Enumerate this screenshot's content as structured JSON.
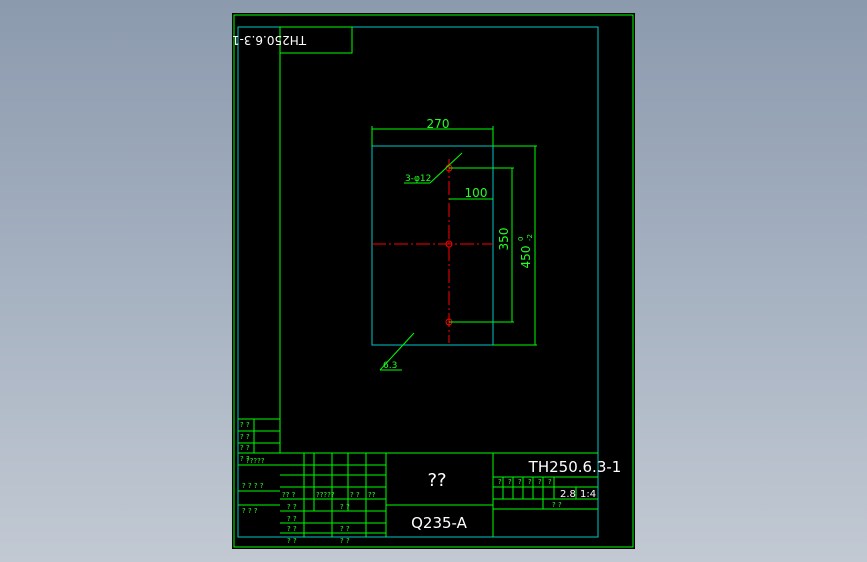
{
  "colors": {
    "frame": "#00ff00",
    "outline": "#00c8c8",
    "centerline": "#ff0000",
    "dimension": "#00ff00",
    "text_white": "#ffffff"
  },
  "drawing": {
    "stamp_code_mirrored": "TH250.6.3-1",
    "dimensions": {
      "width": "270",
      "hole_offset": "100",
      "hole_spacing": "350",
      "height": "450",
      "height_tol_upper": "0",
      "height_tol_lower": "-2",
      "holes": "3-φ12",
      "roughness": "6.3"
    }
  },
  "title_block": {
    "part_name": "??",
    "material": "Q235-A",
    "drawing_no": "TH250.6.3-1",
    "weight": "2.8",
    "scale": "1:4",
    "header_cells": [
      "?",
      "?",
      "?",
      "?",
      "?",
      "?"
    ],
    "small_labels": {
      "row1": "?? ?",
      "row2": "?????",
      "row3": "? ?",
      "row4": "?????",
      "row5": "??",
      "q1": "? ?",
      "q2": "? ?",
      "q3": "? ?",
      "q4": "?????",
      "q5": "? ? ?",
      "q6": "? ? ?",
      "q7": "? ?",
      "q8": "? ?",
      "q9": "? ?",
      "q10": "? ?",
      "q11": "? ?"
    },
    "left_column": [
      "? ?",
      "? ?",
      "? ?",
      "? ?",
      "?????",
      "? ? ? ?",
      "? ? ?"
    ]
  }
}
